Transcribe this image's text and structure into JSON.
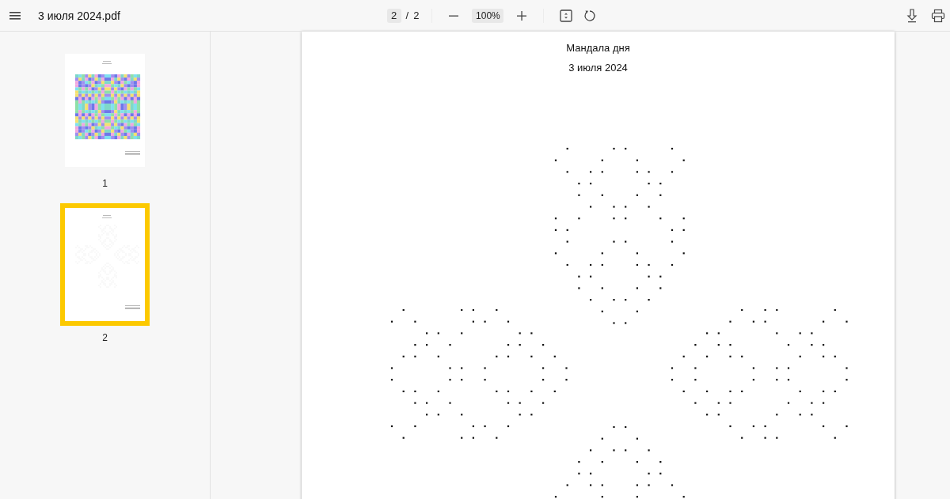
{
  "toolbar": {
    "file_name": "3 июля 2024.pdf",
    "page_number": "2",
    "page_separator": "/",
    "page_total": "2",
    "zoom": "100%"
  },
  "thumbnails": [
    {
      "label": "1",
      "selected": false,
      "kind": "color"
    },
    {
      "label": "2",
      "selected": true,
      "kind": "dots"
    }
  ],
  "page": {
    "title": "Мандала дня",
    "date": "3 июля 2024"
  }
}
